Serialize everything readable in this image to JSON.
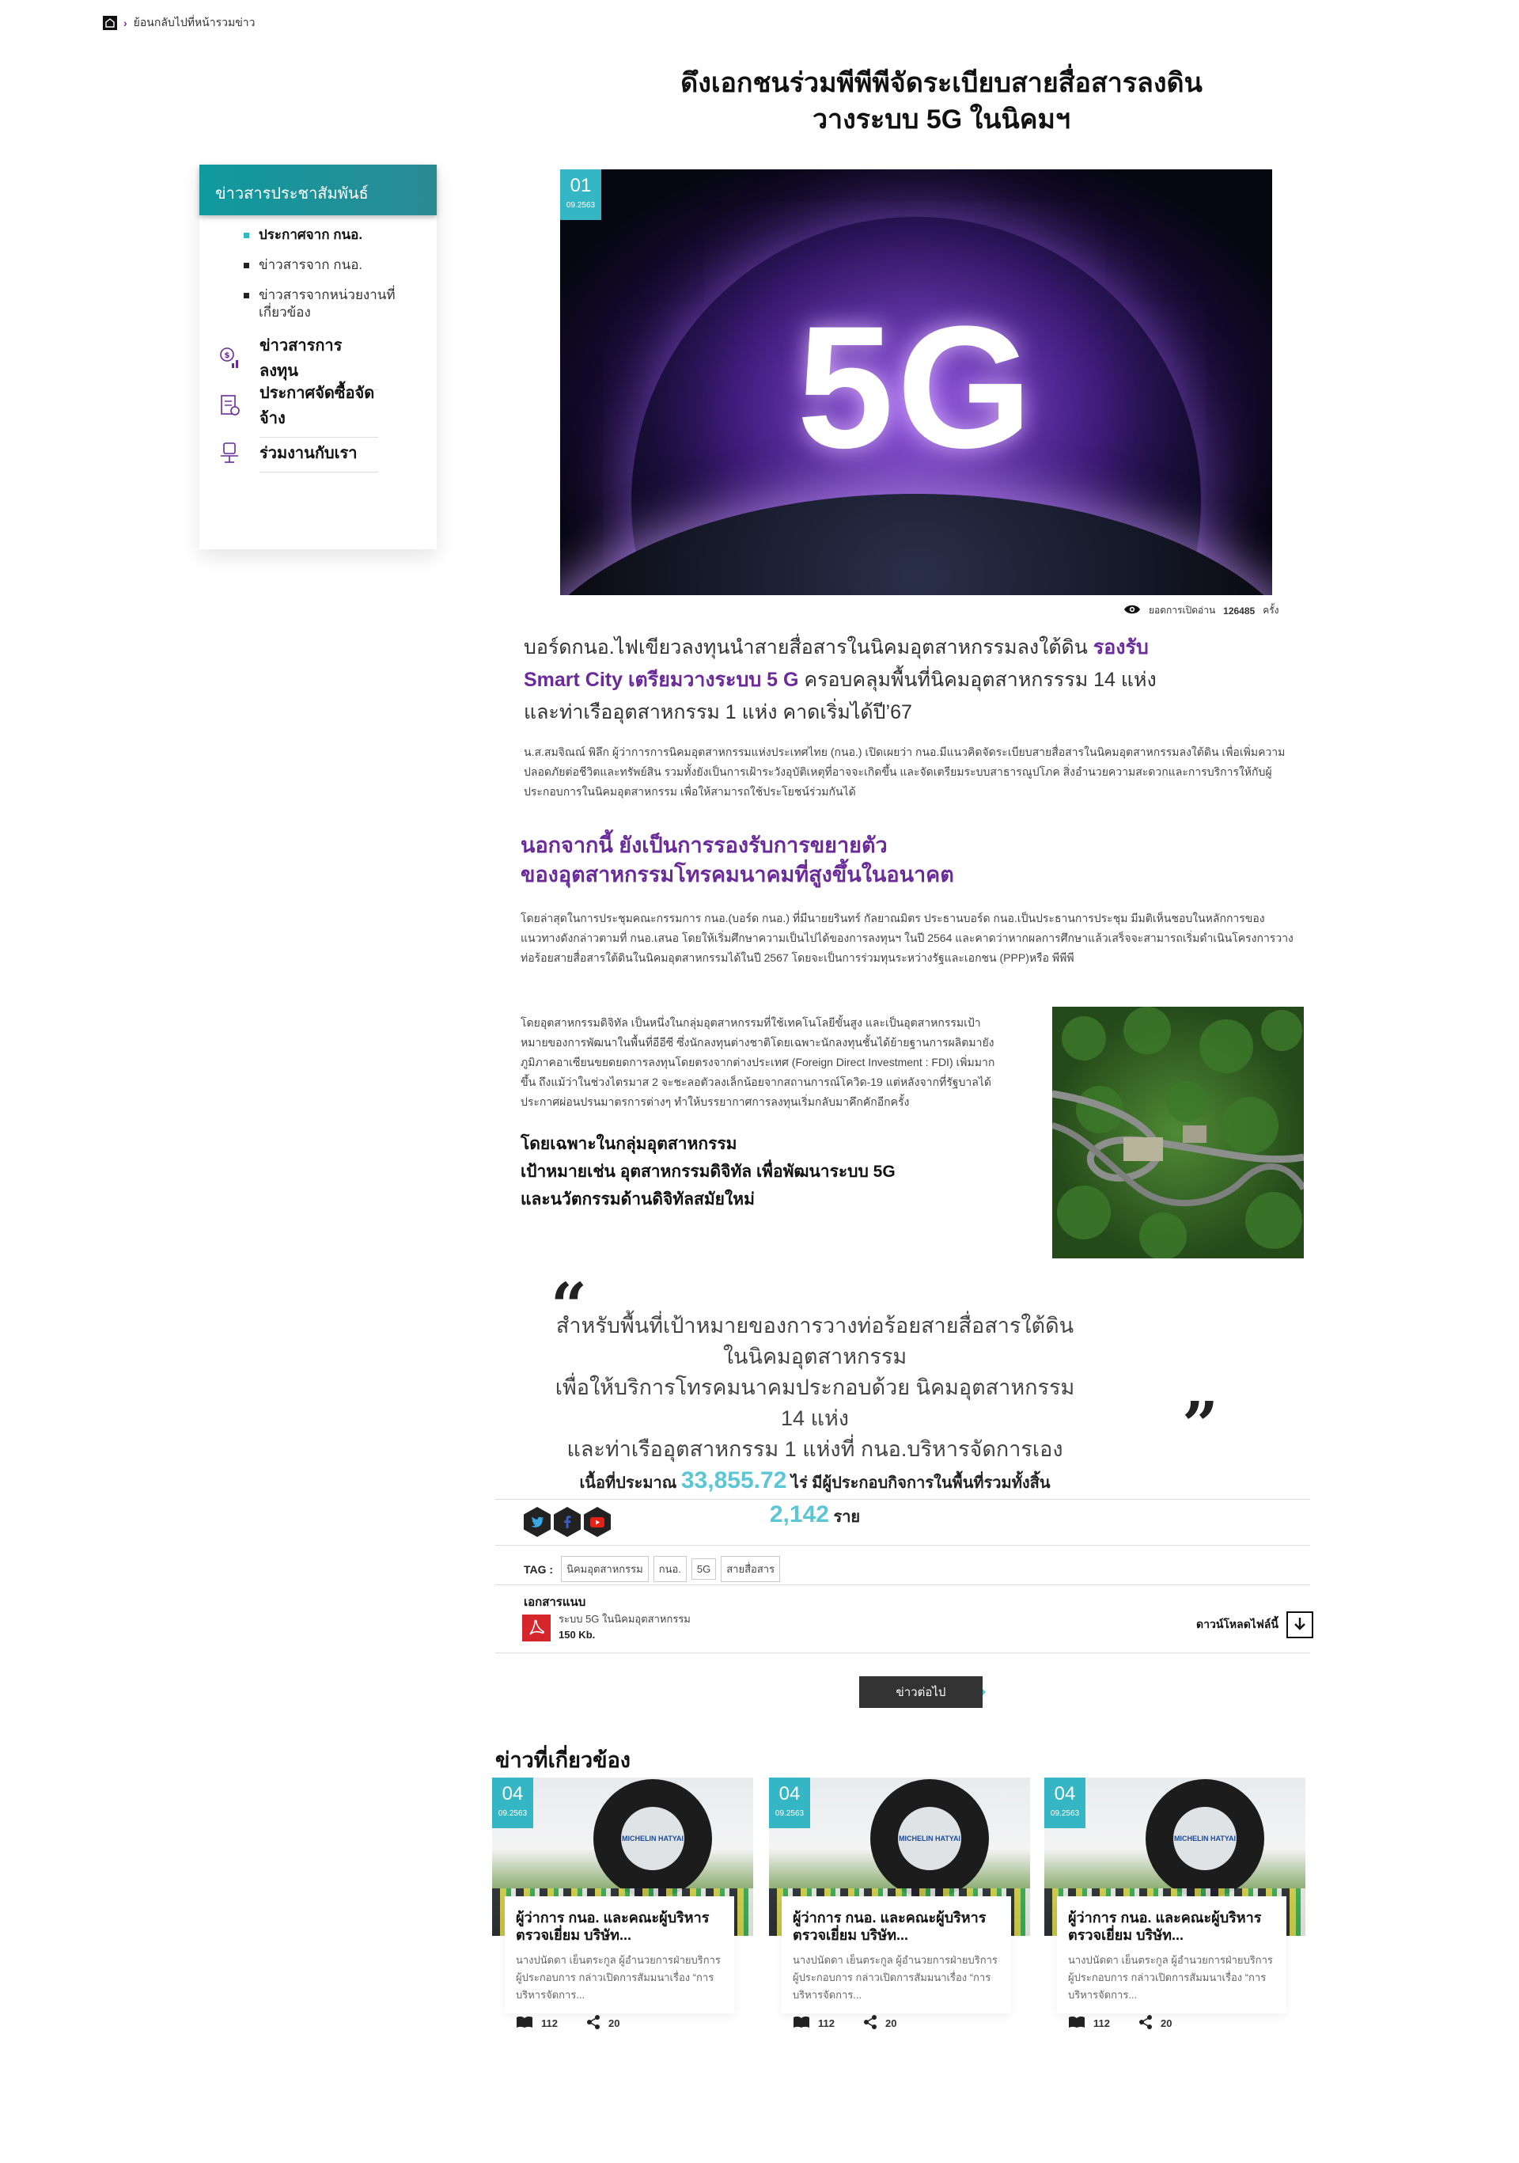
{
  "breadcrumb": {
    "back_label": "ย้อนกลับไปที่หน้ารวมข่าว"
  },
  "title": {
    "line1": "ดึงเอกชนร่วมพีพีพีจัดระเบียบสายสื่อสารลงดิน",
    "line2": "วางระบบ 5G ในนิคมฯ"
  },
  "sidebar": {
    "header": "ข่าวสารประชาสัมพันธ์",
    "sub_items": [
      {
        "label": "ประกาศจาก กนอ.",
        "active": true
      },
      {
        "label": "ข่าวสารจาก กนอ.",
        "active": false
      },
      {
        "label": "ข่าวสารจากหน่วยงานที่เกี่ยวข้อง",
        "active": false
      }
    ],
    "main_items": [
      {
        "label": "ข่าวสารการลงทุน",
        "icon": "investment-icon"
      },
      {
        "label": "ประกาศจัดซื้อจัดจ้าง",
        "icon": "procurement-icon"
      },
      {
        "label": "ร่วมงานกับเรา",
        "icon": "career-icon"
      }
    ]
  },
  "hero": {
    "text": "5G",
    "day": "01",
    "month": "09.2563"
  },
  "views": {
    "label": "ยอดการเปิดอ่าน",
    "count": "126485",
    "unit": "ครั้ง"
  },
  "lead": {
    "part1": "บอร์ดกนอ.ไฟเขียวลงทุนนำสายสื่อสารในนิคมอุตสาหกรรมลงใต้ดิน ",
    "hl1": "รองรับ",
    "hl2": "Smart City เตรียมวางระบบ 5 G",
    "part2": " ครอบคลุมพื้นที่นิคมอุตสาหกรรรม 14 แห่ง",
    "part3": "และท่าเรืออุตสาหกรรม 1 แห่ง คาดเริ่มได้ปี’67"
  },
  "para1": "น.ส.สมจิณณ์ พิลึก ผู้ว่าการการนิคมอุตสาหกรรมแห่งประเทศไทย (กนอ.) เปิดเผยว่า กนอ.มีแนวคิดจัดระเบียบสายสื่อสารในนิคมอุตสาหกรรมลงใต้ดิน เพื่อเพิ่มความปลอดภัยต่อชีวิตและทรัพย์สิน รวมทั้งยังเป็นการเฝ้าระวังอุบัติเหตุที่อาจจะเกิดขึ้น และจัดเตรียมระบบสาธารณูปโภค สิ่งอำนวยความสะดวกและการบริการให้กับผู้ประกอบการในนิคมอุตสาหกรรม เพื่อให้สามารถใช้ประโยชน์ร่วมกันได้",
  "heading2": {
    "line1": "นอกจากนี้ ยังเป็นการรองรับการขยายตัว",
    "line2": "ของอุตสาหกรรมโทรคมนาคมที่สูงขึ้นในอนาคต"
  },
  "para2": "โดยล่าสุดในการประชุมคณะกรรมการ กนอ.(บอร์ด กนอ.) ที่มีนายยรินทร์ กัลยาณมิตร ประธานบอร์ด กนอ.เป็นประธานการประชุม มีมติเห็นชอบในหลักการของแนวทางดังกล่าวตามที่ กนอ.เสนอ โดยให้เริ่มศึกษาความเป็นไปได้ของการลงทุนฯ ในปี 2564 และคาดว่าหากผลการศึกษาแล้วเสร็จจะสามารถเริ่มดำเนินโครงการวางท่อร้อยสายสื่อสารใต้ดินในนิคมอุตสาหกรรมได้ในปี 2567 โดยจะเป็นการร่วมทุนระหว่างรัฐและเอกชน (PPP)หรือ พีพีพี",
  "para3": "โดยอุตสาหกรรมดิจิทัล เป็นหนึ่งในกลุ่มอุตสาหกรรมที่ใช้เทคโนโลยีขั้นสูง และเป็นอุตสาหกรรมเป้าหมายของการพัฒนาในพื้นที่อีอีซี ซึ่งนักลงทุนต่างชาติโดยเฉพาะนักลงทุนชั้นได้ย้ายฐานการผลิตมายังภูมิภาคอาเซียนขยดยดการลงทุนโดยตรงจากต่างประเทศ (Foreign Direct Investment : FDI) เพิ่มมากขึ้น ถึงแม้ว่าในช่วงไตรมาส 2 จะชะลอตัวลงเล็กน้อยจากสถานการณ์โควิด-19 แต่หลังจากที่รัฐบาลได้ประกาศผ่อนปรนมาตรการต่างๆ ทำให้บรรยากาศการลงทุนเริ่มกลับมาคึกคักอีกครั้ง",
  "subhead": {
    "line1": "โดยเฉพาะในกลุ่มอุตสาหกรรม",
    "line2": "เป้าหมายเช่น อุตสาหกรรมดิจิทัล เพื่อพัฒนาระบบ 5G",
    "line3": "และนวัตกรรมด้านดิจิทัลสมัยใหม่"
  },
  "quote": {
    "line1": "สำหรับพื้นที่เป้าหมายของการวางท่อร้อยสายสื่อสารใต้ดินในนิคมอุตสาหกรรม",
    "line2": "เพื่อให้บริการโทรคมนาคมประกอบด้วย นิคมอุตสาหกรรม 14 แห่ง",
    "line3": "และท่าเรืออุตสาหกรรม 1 แห่งที่ กนอ.บริหารจัดการเอง",
    "l4a": "เนื้อที่ประมาณ ",
    "area": "33,855.72",
    "l4b": " ไร่ มีผู้ประกอบกิจการในพื้นที่รวมทั้งสิ้น ",
    "count": "2,142",
    "l4c": " ราย"
  },
  "tags": {
    "label": "TAG :",
    "items": [
      "นิคมอุตสาหกรรม",
      "กนอ.",
      "5G",
      "สายสื่อสาร"
    ]
  },
  "attachment": {
    "title": "เอกสารแนบ",
    "name": "ระบบ 5G ในนิคมอุตสาหกรรม",
    "size": "150 Kb.",
    "download_label": "ดาวน์โหลดไฟล์นี้"
  },
  "next_label": "ข่าวต่อไป",
  "related": {
    "title": "ข่าวที่เกี่ยวข้อง",
    "cards": [
      {
        "day": "04",
        "month": "09.2563",
        "title": "ผู้ว่าการ กนอ. และคณะผู้บริหารตรวจเยี่ยม บริษัท...",
        "desc": "นางปนัดดา เย็นตระกูล ผู้อำนวยการฝ่ายบริการผู้ประกอบการ กล่าวเปิดการสัมมนาเรื่อง “การบริหารจัดการ...",
        "reads": "112",
        "shares": "20",
        "logo": "MICHELIN HATYAI"
      },
      {
        "day": "04",
        "month": "09.2563",
        "title": "ผู้ว่าการ กนอ. และคณะผู้บริหารตรวจเยี่ยม บริษัท...",
        "desc": "นางปนัดดา เย็นตระกูล ผู้อำนวยการฝ่ายบริการผู้ประกอบการ กล่าวเปิดการสัมมนาเรื่อง “การบริหารจัดการ...",
        "reads": "112",
        "shares": "20",
        "logo": "MICHELIN HATYAI"
      },
      {
        "day": "04",
        "month": "09.2563",
        "title": "ผู้ว่าการ กนอ. และคณะผู้บริหารตรวจเยี่ยม บริษัท...",
        "desc": "นางปนัดดา เย็นตระกูล ผู้อำนวยการฝ่ายบริการผู้ประกอบการ กล่าวเปิดการสัมมนาเรื่อง “การบริหารจัดการ...",
        "reads": "112",
        "shares": "20",
        "logo": "MICHELIN HATYAI"
      }
    ]
  },
  "colors": {
    "accent_teal": "#34b6c4",
    "accent_purple": "#6a2a9a",
    "quote_number": "#5cc7d4"
  }
}
